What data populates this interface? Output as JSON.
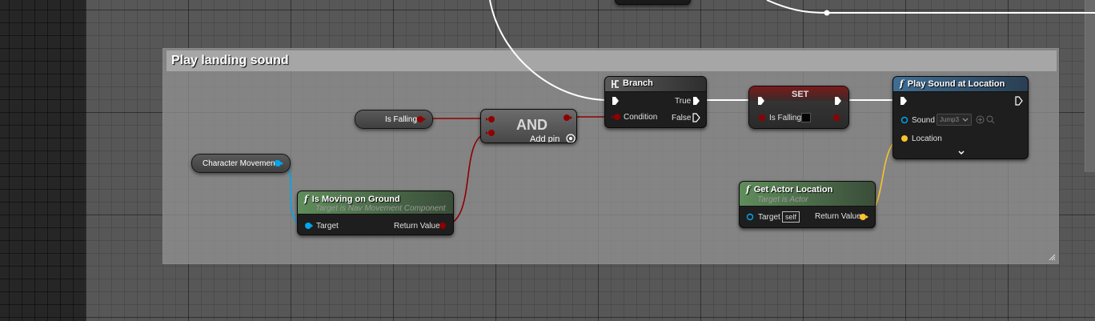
{
  "comment": {
    "title": "Play landing sound"
  },
  "variables": {
    "is_falling": "Is Falling",
    "character_movement": "Character Movement"
  },
  "and_node": {
    "title": "AND",
    "add_pin": "Add pin"
  },
  "branch": {
    "title": "Branch",
    "true_label": "True",
    "false_label": "False",
    "condition_label": "Condition"
  },
  "set_node": {
    "title": "SET",
    "var_label": "Is Falling"
  },
  "play_sound": {
    "title": "Play Sound at Location",
    "sound_label": "Sound",
    "sound_value": "Jump3",
    "location_label": "Location"
  },
  "is_moving": {
    "title": "Is Moving on Ground",
    "subtitle": "Target is Nav Movement Component",
    "target_label": "Target",
    "return_label": "Return Value"
  },
  "get_location": {
    "title": "Get Actor Location",
    "subtitle": "Target is Actor",
    "target_label": "Target",
    "self_value": "self",
    "return_label": "Return Value"
  },
  "colors": {
    "exec": "#ffffff",
    "bool": "#8f0000",
    "object": "#00a7f0",
    "vector": "#f6c42b",
    "pure_header": "#4f7a4c",
    "call_header": "#3f6e95"
  }
}
